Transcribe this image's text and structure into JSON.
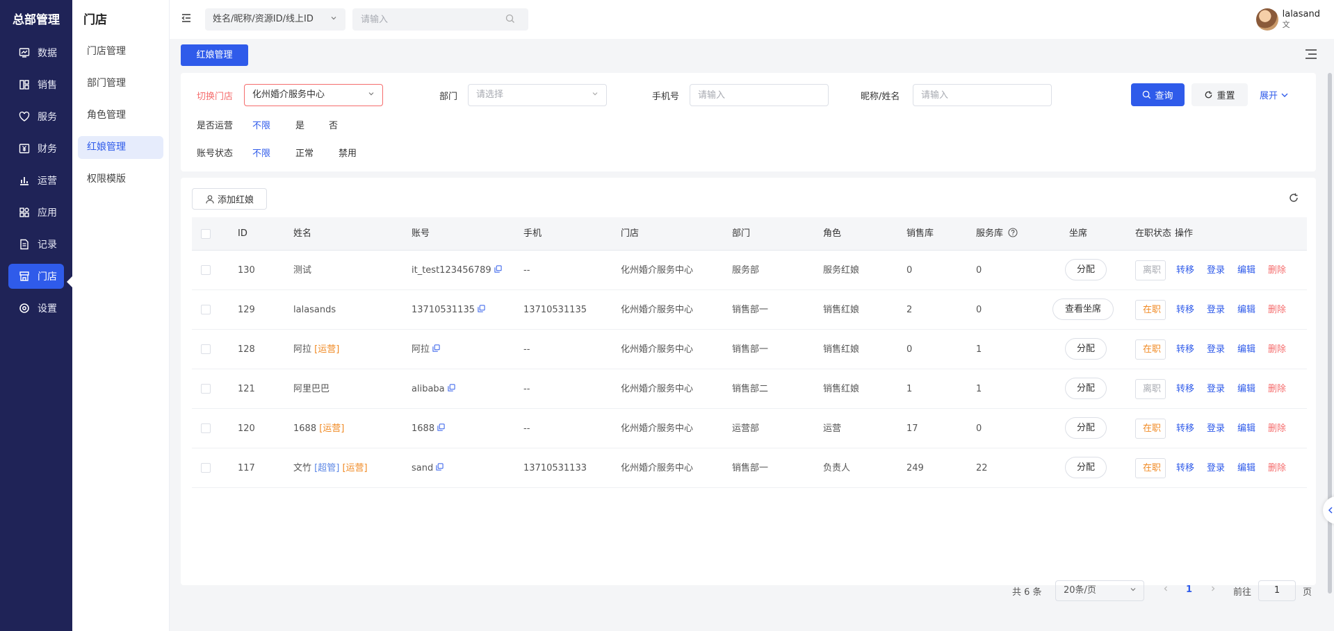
{
  "nav": {
    "title": "总部管理",
    "items": [
      {
        "label": "数据",
        "icon": "monitor-chart-icon"
      },
      {
        "label": "销售",
        "icon": "grid-book-icon"
      },
      {
        "label": "服务",
        "icon": "heart-icon"
      },
      {
        "label": "财务",
        "icon": "yen-icon"
      },
      {
        "label": "运营",
        "icon": "bar-chart-icon"
      },
      {
        "label": "应用",
        "icon": "apps-icon"
      },
      {
        "label": "记录",
        "icon": "document-icon"
      },
      {
        "label": "门店",
        "icon": "store-icon",
        "active": true
      },
      {
        "label": "设置",
        "icon": "settings-icon"
      }
    ]
  },
  "submenu": {
    "title": "门店",
    "items": [
      "门店管理",
      "部门管理",
      "角色管理",
      "红娘管理",
      "权限模版"
    ],
    "active": "红娘管理"
  },
  "topbar": {
    "search_type": "姓名/昵称/资源ID/线上ID",
    "search_placeholder": "请输入",
    "user_name": "lalasand",
    "user_sub": "文"
  },
  "page_tag": "红娘管理",
  "filter": {
    "store_label": "切换门店",
    "store_value": "化州婚介服务中心",
    "dept_label": "部门",
    "dept_placeholder": "请选择",
    "phone_label": "手机号",
    "phone_placeholder": "请输入",
    "nick_label": "昵称/姓名",
    "nick_placeholder": "请输入",
    "query_label": "查询",
    "reset_label": "重置",
    "expand_label": "展开",
    "ops_label": "是否运营",
    "ops_options": [
      "不限",
      "是",
      "否"
    ],
    "status_label": "账号状态",
    "status_options": [
      "不限",
      "正常",
      "禁用"
    ]
  },
  "table": {
    "add_label": "添加红娘",
    "columns": {
      "id": "ID",
      "name": "姓名",
      "account": "账号",
      "phone": "手机",
      "store": "门店",
      "dept": "部门",
      "role": "角色",
      "sales": "销售库",
      "service": "服务库",
      "seat": "坐席",
      "status": "在职状态",
      "action": "操作"
    },
    "actions": {
      "transfer": "转移",
      "login": "登录",
      "edit": "编辑",
      "delete": "删除"
    },
    "rows": [
      {
        "id": "130",
        "name": "测试",
        "tags": [],
        "account": "it_test123456789",
        "phone": "--",
        "store": "化州婚介服务中心",
        "dept": "服务部",
        "role": "服务红娘",
        "sales": "0",
        "service": "0",
        "seat": "分配",
        "status": "离职",
        "status_type": "off"
      },
      {
        "id": "129",
        "name": "lalasands",
        "tags": [],
        "account": "13710531135",
        "phone": "13710531135",
        "store": "化州婚介服务中心",
        "dept": "销售部一",
        "role": "销售红娘",
        "sales": "2",
        "service": "0",
        "seat": "查看坐席",
        "status": "在职",
        "status_type": "on"
      },
      {
        "id": "128",
        "name": "阿拉",
        "tags": [
          {
            "text": "[运营]",
            "color": "orange"
          }
        ],
        "account": "阿拉",
        "phone": "--",
        "store": "化州婚介服务中心",
        "dept": "销售部一",
        "role": "销售红娘",
        "sales": "0",
        "service": "1",
        "seat": "分配",
        "status": "在职",
        "status_type": "on"
      },
      {
        "id": "121",
        "name": "阿里巴巴",
        "tags": [],
        "account": "alibaba",
        "phone": "--",
        "store": "化州婚介服务中心",
        "dept": "销售部二",
        "role": "销售红娘",
        "sales": "1",
        "service": "1",
        "seat": "分配",
        "status": "离职",
        "status_type": "off"
      },
      {
        "id": "120",
        "name": "1688",
        "tags": [
          {
            "text": "[运营]",
            "color": "orange"
          }
        ],
        "account": "1688",
        "phone": "--",
        "store": "化州婚介服务中心",
        "dept": "运营部",
        "role": "运营",
        "sales": "17",
        "service": "0",
        "seat": "分配",
        "status": "在职",
        "status_type": "on"
      },
      {
        "id": "117",
        "name": "文竹",
        "tags": [
          {
            "text": "[超管]",
            "color": "blue"
          },
          {
            "text": "[运营]",
            "color": "orange"
          }
        ],
        "account": "sand",
        "phone": "13710531133",
        "store": "化州婚介服务中心",
        "dept": "销售部一",
        "role": "负责人",
        "sales": "249",
        "service": "22",
        "seat": "分配",
        "status": "在职",
        "status_type": "on"
      }
    ]
  },
  "pagination": {
    "total": "共 6 条",
    "page_size": "20条/页",
    "current": "1",
    "goto_label": "前往",
    "goto_value": "1",
    "unit": "页"
  },
  "colors": {
    "primary": "#2f5bea",
    "nav_bg": "#1f2357",
    "danger": "#f56c6c",
    "warning": "#f08a24"
  }
}
